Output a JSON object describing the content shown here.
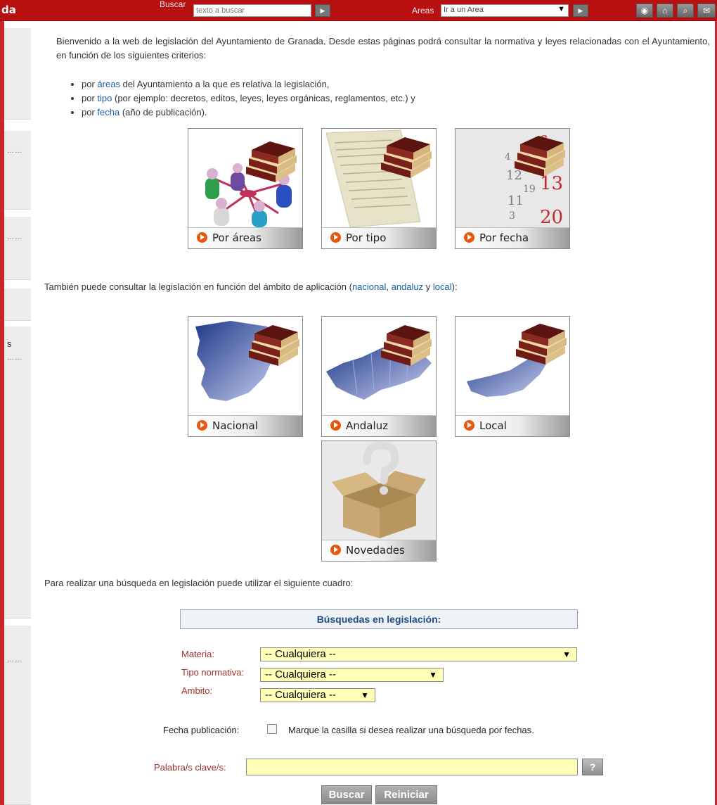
{
  "header": {
    "site_fragment": "da",
    "search_label": "Buscar",
    "search_placeholder": "texto a buscar",
    "areas_label": "Areas",
    "area_select_value": "Ir a un Area",
    "icons": [
      "rss-icon",
      "home-icon",
      "search-icon",
      "mail-icon"
    ],
    "accent_color": "#b80f10"
  },
  "left": {
    "letter": "s"
  },
  "intro": {
    "text": "Bienvenido a la web de legislación del Ayuntamiento de Granada. Desde estas páginas podrá consultar la normativa y leyes relacionadas con el Ayuntamiento, en función de los siguientes criterios:",
    "criteria": [
      {
        "pre": "por ",
        "link": "áreas",
        "post": " del Ayuntamiento a la que es relativa la legislación,"
      },
      {
        "pre": "por ",
        "link": "tipo",
        "post": " (por ejemplo: decretos, editos, leyes, leyes orgánicas, reglamentos, etc.) y"
      },
      {
        "pre": "por ",
        "link": "fecha",
        "post": " (año de publicación)."
      }
    ]
  },
  "tiles_primary": [
    {
      "label": "Por áreas"
    },
    {
      "label": "Por tipo"
    },
    {
      "label": "Por fecha"
    }
  ],
  "calendar_numbers": [
    "6",
    "13",
    "20",
    "12",
    "19",
    "4",
    "11",
    "3"
  ],
  "scope": {
    "pre": "También puede consultar la legislación en función del ámbito de aplicación (",
    "links": [
      "nacional",
      "andaluz",
      "local"
    ],
    "sep1": ", ",
    "sep2": " y ",
    "post": "):"
  },
  "tiles_scope": [
    {
      "label": "Nacional"
    },
    {
      "label": "Andaluz"
    },
    {
      "label": "Local"
    },
    {
      "label": "Novedades"
    }
  ],
  "search": {
    "intro": "Para realizar una búsqueda en legislación puede utilizar el siguiente cuadro:",
    "title": "Búsquedas en legislación:",
    "materia_label": "Materia:",
    "materia_value": "-- Cualquiera --",
    "tipo_label": "Tipo normativa:",
    "tipo_value": "-- Cualquiera --",
    "ambito_label": "Ambito:",
    "ambito_value": "-- Cualquiera --",
    "fecha_label": "Fecha publicación:",
    "fecha_hint": "Marque la casilla si desea realizar una búsqueda por fechas.",
    "keyword_label": "Palabra/s clave/s:",
    "keyword_value": "",
    "help_label": "?",
    "search_button": "Buscar",
    "reset_button": "Reiniciar"
  }
}
